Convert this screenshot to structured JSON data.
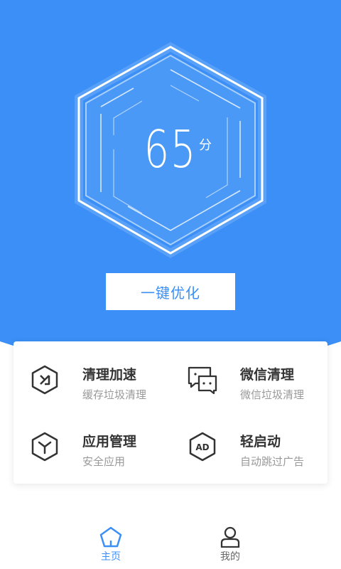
{
  "score": {
    "value": "65",
    "unit": "分"
  },
  "optimize_button": "一键优化",
  "features": [
    {
      "title": "清理加速",
      "subtitle": "缓存垃圾清理",
      "icon": "speed-icon"
    },
    {
      "title": "微信清理",
      "subtitle": "微信垃圾清理",
      "icon": "chat-icon"
    },
    {
      "title": "应用管理",
      "subtitle": "安全应用",
      "icon": "app-icon"
    },
    {
      "title": "轻启动",
      "subtitle": "自动跳过广告",
      "icon": "ad-icon"
    }
  ],
  "ad_icon_text": "AD",
  "tabs": [
    {
      "label": "主页",
      "icon": "home-icon",
      "active": true
    },
    {
      "label": "我的",
      "icon": "user-icon",
      "active": false
    }
  ],
  "colors": {
    "primary": "#3b8ff6",
    "text": "#333333",
    "subtext": "#999999"
  }
}
